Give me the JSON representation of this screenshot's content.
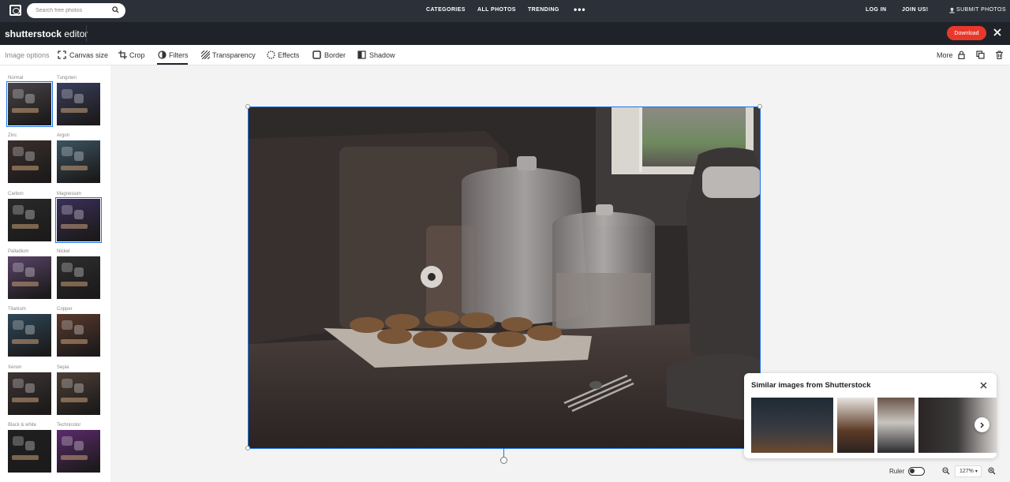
{
  "site": {
    "search_placeholder": "Search free photos",
    "nav": [
      "CATEGORIES",
      "ALL PHOTOS",
      "TRENDING"
    ],
    "more_dots": "•••",
    "log_in": "LOG IN",
    "join": "JOIN US!",
    "submit": "SUBMIT PHOTOS"
  },
  "editor": {
    "brand_bold": "shutterstock",
    "brand_light": " editor",
    "download": "Download"
  },
  "toolbar": {
    "image_options": "Image options",
    "tabs": [
      "Canvas size",
      "Crop",
      "Filters",
      "Transparency",
      "Effects",
      "Border",
      "Shadow"
    ],
    "more": "More"
  },
  "filters": [
    {
      "name": "Normal",
      "color": "#4a4448"
    },
    {
      "name": "Tungsten",
      "color": "#3a3f5e"
    },
    {
      "name": "Zinc",
      "color": "#3a2f2c"
    },
    {
      "name": "Argon",
      "color": "#3b5462"
    },
    {
      "name": "Carbon",
      "color": "#2a2a2a"
    },
    {
      "name": "Magnesium",
      "color": "#3b2f5a"
    },
    {
      "name": "Palladium",
      "color": "#5a4468"
    },
    {
      "name": "Nickel",
      "color": "#2e2e30"
    },
    {
      "name": "Titanium",
      "color": "#2e4858"
    },
    {
      "name": "Copper",
      "color": "#5a3a2c"
    },
    {
      "name": "Xenon",
      "color": "#3e3434"
    },
    {
      "name": "Sepia",
      "color": "#4e3f36"
    },
    {
      "name": "Black & white",
      "color": "#202020"
    },
    {
      "name": "Technicolor",
      "color": "#5c2a6e"
    }
  ],
  "selected_filters": [
    "Normal",
    "Magnesium"
  ],
  "similar": {
    "title": "Similar images from Shutterstock"
  },
  "bottom": {
    "ruler": "Ruler",
    "zoom": "127%"
  }
}
